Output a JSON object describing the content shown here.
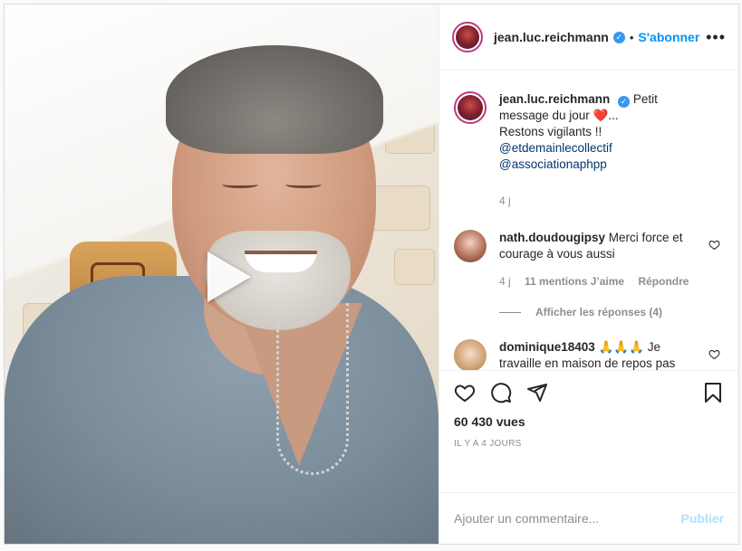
{
  "post": {
    "username": "jean.luc.reichmann",
    "verified_icon": "verified-badge-icon",
    "follow_label": "S'abonner",
    "more_label": "•••"
  },
  "caption": {
    "username": "jean.luc.reichmann",
    "text_1": "Petit message du jour",
    "text_2": "...",
    "text_3": " Restons vigilants !!",
    "mention_1": "@etdemainlecollectif",
    "mention_2": "@associationaphpp",
    "time": "4 j"
  },
  "comments": [
    {
      "username": "nath.doudougipsy",
      "text": "Merci force et courage à vous aussi",
      "time": "4 j",
      "likes": "11 mentions J’aime",
      "reply_label": "Répondre",
      "view_replies": "Afficher les réponses (4)"
    },
    {
      "username": "dominique18403",
      "text_emoji": "🙏🙏🙏",
      "text": "Je travaille en maison de repos pas facile en ce moment soyons prudents merci pour votre gentillesse",
      "text_end": "❤️❤️❤️👏👏👏👏"
    }
  ],
  "actions": {
    "views": "60 430 vues",
    "time_ago": "IL Y A 4 JOURS"
  },
  "add_comment": {
    "placeholder": "Ajouter un commentaire...",
    "publish_label": "Publier"
  },
  "colors": {
    "accent": "#0095f6",
    "verified": "#3897f0",
    "publish_disabled": "#b2dffc"
  }
}
